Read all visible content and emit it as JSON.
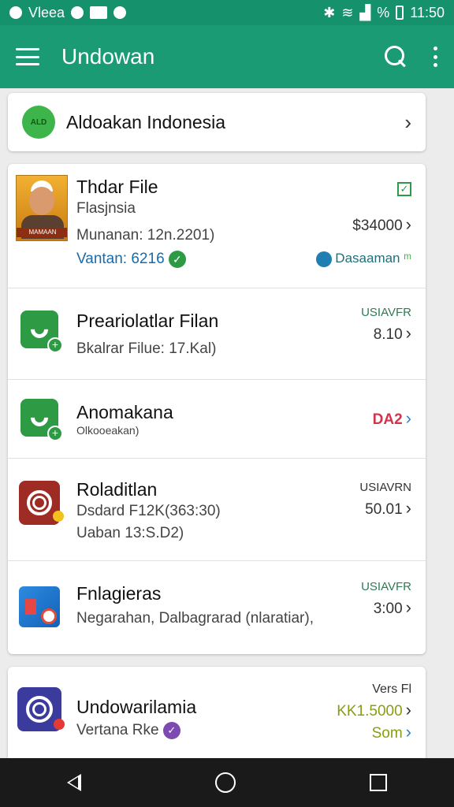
{
  "status_bar": {
    "carrier": "Vleea",
    "battery": "%",
    "time": "11:50"
  },
  "app_bar": {
    "title": "Undowan"
  },
  "header_card": {
    "logo_text": "ALD",
    "title": "Aldoakan Indonesia"
  },
  "list": [
    {
      "title": "Thdar File",
      "subtitle": "Flasjnsia",
      "meta": "Munanan: 12n.2201)",
      "extra": "Vantan: 6216",
      "price": "$34000",
      "tag": "Dasaaman",
      "thumb_label": "MAMAAN"
    },
    {
      "title": "Preariolatlar Filan",
      "subtitle": "Bkalrar Filue: 17.Kal)",
      "price_label": "USIAVFR",
      "price": "8.10"
    },
    {
      "title": "Anomakana",
      "subtitle": "Olkooeakan)",
      "price": "DA2"
    },
    {
      "title": "Roladitlan",
      "subtitle": "Dsdard F12K(363:30)",
      "meta": "Uaban 13:S.D2)",
      "price_label": "USIAVRN",
      "price": "50.01"
    },
    {
      "title": "Fnlagieras",
      "subtitle": "Negarahan, Dalbagrarad (nlaratiar),",
      "price_label": "USIAVFR",
      "price": "3:00"
    }
  ],
  "bottom_item": {
    "title": "Undowarilamia",
    "subtitle": "Vertana Rke",
    "price_label": "Vers Fl",
    "price": "KK1.5000",
    "tag": "Som"
  },
  "icons": {
    "menu": "menu-icon",
    "search": "search-icon",
    "more": "more-vert-icon",
    "chevron": "chevron-right-icon"
  },
  "colors": {
    "primary": "#1a9b73",
    "status_bar": "#15916c",
    "price_red": "#d2344b",
    "accent_green": "#2e9b44",
    "accent_olive": "#8a9d12"
  }
}
